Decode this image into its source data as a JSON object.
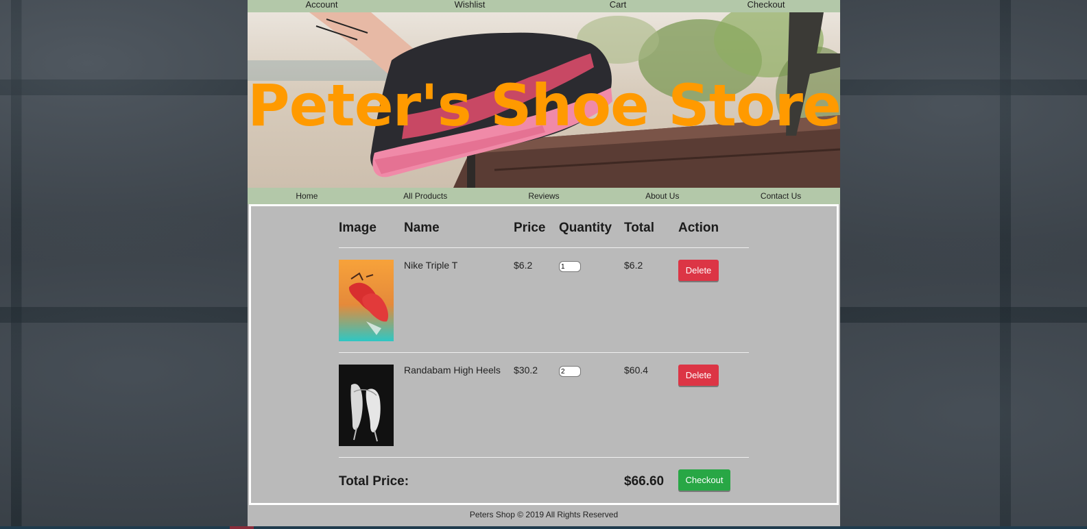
{
  "top_nav": {
    "items": [
      "Account",
      "Wishlist",
      "Cart",
      "Checkout"
    ]
  },
  "hero": {
    "title": "Peter's Shoe Store"
  },
  "main_nav": {
    "items": [
      "Home",
      "All Products",
      "Reviews",
      "About Us",
      "Contact Us"
    ]
  },
  "cart": {
    "headers": {
      "image": "Image",
      "name": "Name",
      "price": "Price",
      "quantity": "Quantity",
      "total": "Total",
      "action": "Action"
    },
    "rows": [
      {
        "name": "Nike Triple T",
        "price": "$6.2",
        "quantity": "1",
        "total": "$6.2",
        "action": "Delete",
        "image_icon": "red-sneakers-image"
      },
      {
        "name": "Randabam High Heels",
        "price": "$30.2",
        "quantity": "2",
        "total": "$60.4",
        "action": "Delete",
        "image_icon": "white-heels-image"
      }
    ],
    "total_label": "Total Price:",
    "total_value": "$66.60",
    "checkout_label": "Checkout"
  },
  "footer": {
    "text": "Peters Shop © 2019 All Rights Reserved"
  },
  "colors": {
    "nav_bg": "#b3c8a9",
    "title": "#ff9a00",
    "delete": "#dc3545",
    "checkout": "#28a745",
    "panel": "#bababa"
  }
}
